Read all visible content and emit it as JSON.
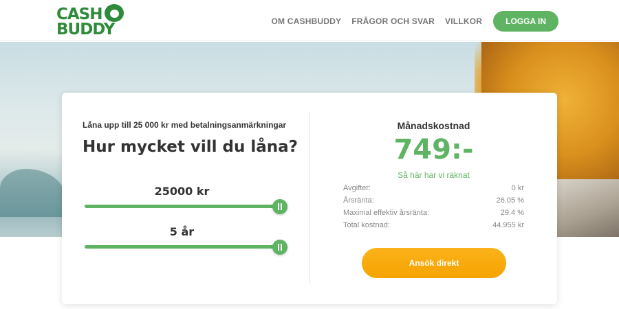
{
  "logo": {
    "line1": "CASH",
    "line2": "BUDDY"
  },
  "nav": {
    "items": [
      {
        "label": "OM CASHBUDDY"
      },
      {
        "label": "FRÅGOR OCH SVAR"
      },
      {
        "label": "VILLKOR"
      }
    ],
    "login_label": "LOGGA IN"
  },
  "calculator": {
    "subtitle": "Låna upp till 25 000 kr med betalningsanmärkningar",
    "question": "Hur mycket vill du låna?",
    "amount": {
      "label": "25000 kr",
      "level": 1.0
    },
    "term": {
      "label": "5 år",
      "level": 1.0
    }
  },
  "summary": {
    "title": "Månadskostnad",
    "value": "749:-",
    "calc_link": "Så här har vi räknat",
    "details": [
      {
        "label": "Avgifter:",
        "value": "0 kr"
      },
      {
        "label": "Årsränta:",
        "value": "26.05 %"
      },
      {
        "label": "Maximal effektiv årsränta:",
        "value": "29.4 %"
      },
      {
        "label": "Total kostnad:",
        "value": "44.955 kr"
      }
    ],
    "apply_label": "Ansök direkt"
  },
  "colors": {
    "brand_green": "#5fb463",
    "logo_green": "#2e8b3a",
    "apply_orange": "#f5a300"
  }
}
